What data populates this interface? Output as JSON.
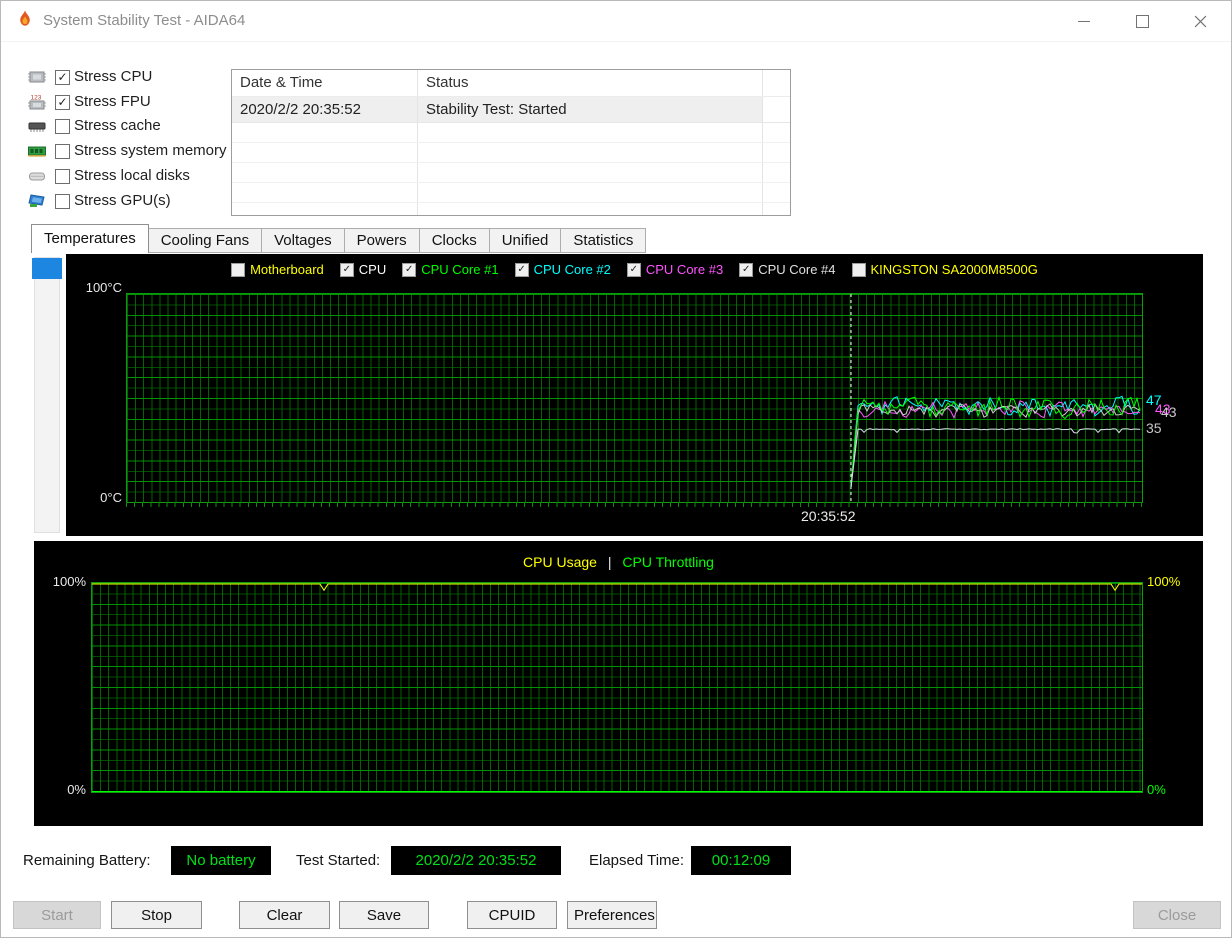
{
  "window": {
    "title": "System Stability Test - AIDA64"
  },
  "glyphs": {
    "checkmark": "✓"
  },
  "stress_options": {
    "items": [
      {
        "label": "Stress CPU",
        "icon": "cpu-icon",
        "checked": true
      },
      {
        "label": "Stress FPU",
        "icon": "fpu-icon",
        "checked": true
      },
      {
        "label": "Stress cache",
        "icon": "cache-icon",
        "checked": false
      },
      {
        "label": "Stress system memory",
        "icon": "memory-icon",
        "checked": false
      },
      {
        "label": "Stress local disks",
        "icon": "disk-icon",
        "checked": false
      },
      {
        "label": "Stress GPU(s)",
        "icon": "gpu-icon",
        "checked": false
      }
    ]
  },
  "log_table": {
    "columns": [
      "Date & Time",
      "Status"
    ],
    "rows": [
      {
        "date": "2020/2/2 20:35:52",
        "status": "Stability Test: Started"
      }
    ],
    "empty_row_count": 5
  },
  "tabs": {
    "items": [
      "Temperatures",
      "Cooling Fans",
      "Voltages",
      "Powers",
      "Clocks",
      "Unified",
      "Statistics"
    ],
    "active": "Temperatures"
  },
  "chart_data": [
    {
      "type": "line",
      "title": "Temperatures",
      "background": "#000000",
      "grid": true,
      "grid_color": "#0c720c",
      "y_axis": {
        "top_label": "100°C",
        "bottom_label": "0°C",
        "min": 0,
        "max": 100,
        "unit": "°C"
      },
      "legend": [
        {
          "label": "Motherboard",
          "color": "#ffff00",
          "checked": false
        },
        {
          "label": "CPU",
          "color": "#ffffff",
          "checked": true
        },
        {
          "label": "CPU Core #1",
          "color": "#00ff00",
          "checked": true
        },
        {
          "label": "CPU Core #2",
          "color": "#00ffff",
          "checked": true
        },
        {
          "label": "CPU Core #3",
          "color": "#ff55ff",
          "checked": true
        },
        {
          "label": "CPU Core #4",
          "color": "#e0e0e0",
          "checked": true
        },
        {
          "label": "KINGSTON SA2000M8500G",
          "color": "#ffff00",
          "checked": false
        }
      ],
      "x_marker": {
        "label": "20:35:52",
        "fraction": 0.713
      },
      "series": [
        {
          "name": "CPU",
          "color": "#dcdcf0",
          "baseline": 35,
          "noise": 0.5,
          "start_fraction": 0.713,
          "current": 35
        },
        {
          "name": "CPU Core #1",
          "color": "#00ff00",
          "baseline": 45.5,
          "noise": 3.8,
          "start_fraction": 0.713,
          "current": 47
        },
        {
          "name": "CPU Core #2",
          "color": "#00ffff",
          "baseline": 46,
          "noise": 3.2,
          "start_fraction": 0.713,
          "current": 47
        },
        {
          "name": "CPU Core #3",
          "color": "#ff55ff",
          "baseline": 44.5,
          "noise": 2.8,
          "start_fraction": 0.713,
          "current": 43
        },
        {
          "name": "CPU Core #4",
          "color": "#cfcfcf",
          "baseline": 44,
          "noise": 2.2,
          "start_fraction": 0.713,
          "current": 43
        }
      ],
      "value_labels": [
        {
          "text": "47",
          "color": "#00ffff",
          "v": 48.5,
          "dx": 0
        },
        {
          "text": "43",
          "color": "#ff55ff",
          "v": 44.0,
          "dx": 9
        },
        {
          "text": "43",
          "color": "#c8c8c8",
          "v": 42.6,
          "dx": 15
        },
        {
          "text": "35",
          "color": "#c8c8c8",
          "v": 35,
          "dx": 0
        }
      ]
    },
    {
      "type": "line",
      "title": "CPU Usage / CPU Throttling",
      "background": "#000000",
      "grid": true,
      "grid_color": "#0c720c",
      "legend": [
        {
          "label": "CPU Usage",
          "color": "#ffff00"
        },
        {
          "label": "CPU Throttling",
          "color": "#00ff00"
        }
      ],
      "legend_separator": "|",
      "y_axis": {
        "left_top": "100%",
        "left_bottom": "0%",
        "right_top": "100%",
        "right_bottom": "0%",
        "min": 0,
        "max": 100,
        "unit": "%"
      },
      "right_label_colors": {
        "top": "#ffff00",
        "bottom": "#00ff00"
      },
      "series": [
        {
          "name": "CPU Usage",
          "color": "#ffff00",
          "baseline": 100,
          "dips": [
            0.221,
            0.974
          ],
          "dip_value": 96.5
        },
        {
          "name": "CPU Throttling",
          "color": "#00ff00",
          "baseline": 0
        }
      ]
    }
  ],
  "status_bar": {
    "battery_label": "Remaining Battery:",
    "battery_value": "No battery",
    "started_label": "Test Started:",
    "started_value": "2020/2/2 20:35:52",
    "elapsed_label": "Elapsed Time:",
    "elapsed_value": "00:12:09",
    "value_color": "#00e018",
    "box_background": "#000000"
  },
  "buttons": [
    {
      "label": "Start",
      "enabled": false
    },
    {
      "label": "Stop",
      "enabled": true
    },
    {
      "label": "Clear",
      "enabled": true
    },
    {
      "label": "Save",
      "enabled": true
    },
    {
      "label": "CPUID",
      "enabled": true
    },
    {
      "label": "Preferences",
      "enabled": true
    },
    {
      "label": "Close",
      "enabled": false
    }
  ]
}
